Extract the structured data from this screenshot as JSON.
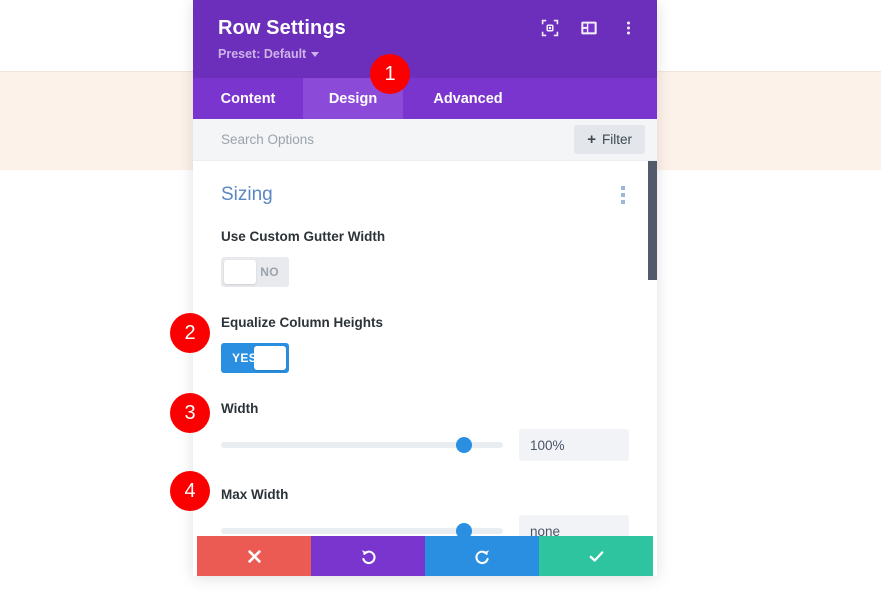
{
  "window": {
    "title": "Row Settings",
    "preset_label": "Preset: Default"
  },
  "header_icons": [
    {
      "name": "focus-target-icon",
      "label": "Focus"
    },
    {
      "name": "layout-panel-icon",
      "label": "Layout"
    },
    {
      "name": "kebab-menu-icon",
      "label": "More options"
    }
  ],
  "tabs": [
    {
      "label": "Content",
      "active": false
    },
    {
      "label": "Design",
      "active": true
    },
    {
      "label": "Advanced",
      "active": false
    }
  ],
  "search": {
    "placeholder": "Search Options",
    "value": "",
    "filter_label": "Filter",
    "filter_plus": "+"
  },
  "section": {
    "title": "Sizing",
    "kebab_name": "section-options-icon"
  },
  "fields": [
    {
      "label": "Use Custom Gutter Width",
      "type": "toggle",
      "state": "off",
      "state_label": "NO"
    },
    {
      "label": "Equalize Column Heights",
      "type": "toggle",
      "state": "on",
      "state_label": "YES"
    },
    {
      "label": "Width",
      "type": "slider",
      "value": "100%",
      "handle_percent": 86
    },
    {
      "label": "Max Width",
      "type": "slider",
      "value": "none",
      "handle_percent": 86
    }
  ],
  "footer_buttons": [
    {
      "name": "cancel-button",
      "icon": "close-icon",
      "color": "#eb5b53"
    },
    {
      "name": "undo-button",
      "icon": "undo-icon",
      "color": "#7b35cf"
    },
    {
      "name": "redo-button",
      "icon": "redo-icon",
      "color": "#2a8fe0"
    },
    {
      "name": "save-button",
      "icon": "check-icon",
      "color": "#2fc4a0"
    }
  ],
  "annotations": [
    {
      "number": "1"
    },
    {
      "number": "2"
    },
    {
      "number": "3"
    },
    {
      "number": "4"
    }
  ],
  "colors": {
    "header_purple": "#6b2fbb",
    "tab_purple": "#7b35cf",
    "tab_active_purple": "#8c4ad8",
    "accent_blue": "#2a8fe0",
    "section_title_blue": "#5b87c4",
    "badge_red": "#fa0000",
    "bg_band_cream": "#fdf2ea"
  }
}
